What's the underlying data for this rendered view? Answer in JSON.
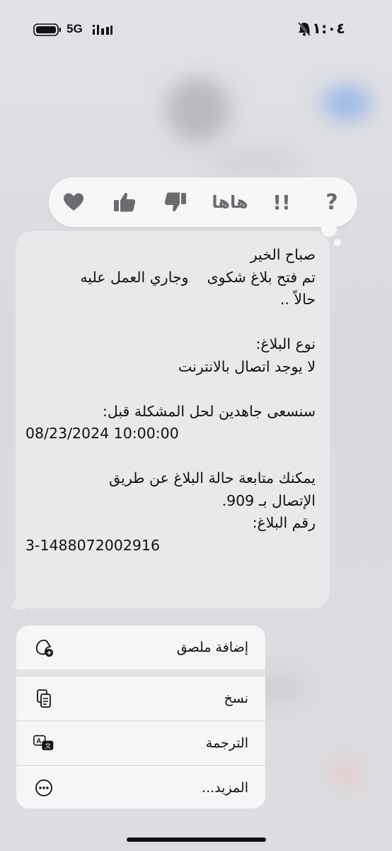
{
  "status_bar": {
    "time": "١١:٠٤",
    "network": "5G",
    "icons": [
      "battery-icon",
      "signal-icon",
      "bell-slash-icon"
    ]
  },
  "reactions": {
    "items": [
      {
        "name": "heart",
        "icon": "heart-icon"
      },
      {
        "name": "thumbs-up",
        "icon": "thumbs-up-icon"
      },
      {
        "name": "thumbs-down",
        "icon": "thumbs-down-icon"
      },
      {
        "name": "haha",
        "label": "هاها"
      },
      {
        "name": "exclamation",
        "label": "!!"
      },
      {
        "name": "question",
        "label": "?"
      }
    ]
  },
  "message": {
    "lines": [
      "صباح الخير",
      "تم فتح بلاغ شكوى    وجاري العمل عليه",
      "حالاً ..",
      "",
      "نوع البلاغ:",
      "لا يوجد اتصال بالانترنت",
      "",
      "سنسعى جاهدين لحل المشكلة قبل:",
      "08/23/2024 10:00:00",
      "",
      "يمكنك متابعة حالة البلاغ عن طريق",
      "الإتصال بـ 909.",
      "رقم البلاغ:",
      "3-1488072002916"
    ]
  },
  "context_menu": {
    "items": [
      {
        "label": "إضافة ملصق",
        "icon": "add-sticker-icon"
      },
      {
        "label": "نسخ",
        "icon": "copy-icon"
      },
      {
        "label": "الترجمة",
        "icon": "translate-icon"
      },
      {
        "label": "المزيد...",
        "icon": "more-icon"
      }
    ]
  }
}
